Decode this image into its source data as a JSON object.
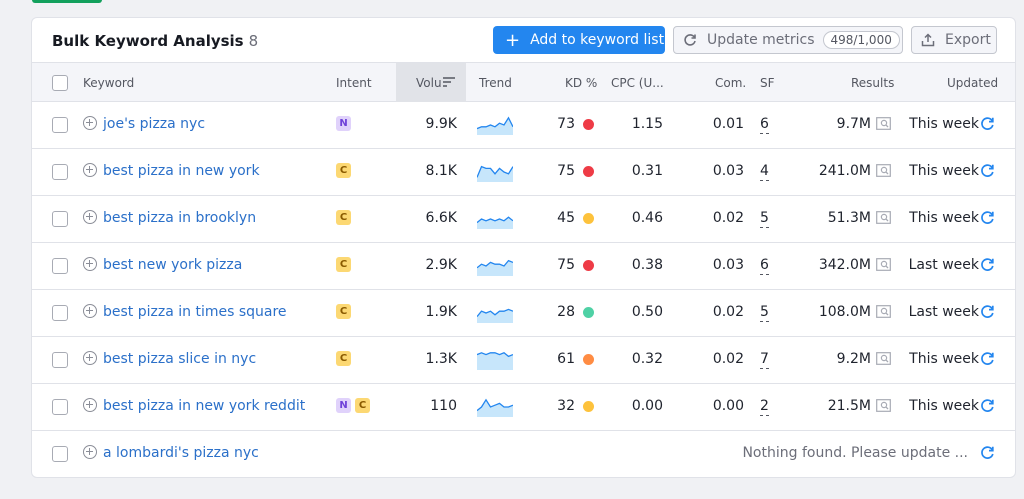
{
  "header": {
    "title": "Bulk Keyword Analysis",
    "count": "8",
    "add_button_label": "Add to keyword list",
    "update_button_label": "Update metrics",
    "update_badge": "498/1,000",
    "export_button_label": "Export"
  },
  "columns": {
    "keyword": "Keyword",
    "intent": "Intent",
    "volume": "Volu",
    "trend": "Trend",
    "kd": "KD %",
    "cpc": "CPC (U...",
    "com": "Com.",
    "sf": "SF",
    "results": "Results",
    "updated": "Updated"
  },
  "rows": [
    {
      "keyword": "joe's pizza nyc",
      "intents": [
        "N"
      ],
      "volume": "9.9K",
      "trend": [
        3,
        4,
        4,
        5,
        4,
        6,
        5,
        9,
        4
      ],
      "kd": "73",
      "kd_color": "#ee3b46",
      "cpc": "1.15",
      "com": "0.01",
      "sf": "6",
      "results": "9.7M",
      "updated": "This week"
    },
    {
      "keyword": "best pizza in new york",
      "intents": [
        "C"
      ],
      "volume": "8.1K",
      "trend": [
        2,
        8,
        7,
        7,
        4,
        7,
        5,
        4,
        8
      ],
      "kd": "75",
      "kd_color": "#ee3b46",
      "cpc": "0.31",
      "com": "0.03",
      "sf": "4",
      "results": "241.0M",
      "updated": "This week"
    },
    {
      "keyword": "best pizza in brooklyn",
      "intents": [
        "C"
      ],
      "volume": "6.6K",
      "trend": [
        3,
        5,
        4,
        5,
        4,
        5,
        4,
        6,
        4
      ],
      "kd": "45",
      "kd_color": "#fdc23c",
      "cpc": "0.46",
      "com": "0.02",
      "sf": "5",
      "results": "51.3M",
      "updated": "This week"
    },
    {
      "keyword": "best new york pizza",
      "intents": [
        "C"
      ],
      "volume": "2.9K",
      "trend": [
        4,
        6,
        5,
        7,
        6,
        6,
        5,
        8,
        7
      ],
      "kd": "75",
      "kd_color": "#ee3b46",
      "cpc": "0.38",
      "com": "0.03",
      "sf": "6",
      "results": "342.0M",
      "updated": "Last week"
    },
    {
      "keyword": "best pizza in times square",
      "intents": [
        "C"
      ],
      "volume": "1.9K",
      "trend": [
        3,
        6,
        5,
        6,
        4,
        6,
        6,
        7,
        6
      ],
      "kd": "28",
      "kd_color": "#4fd1a5",
      "cpc": "0.50",
      "com": "0.02",
      "sf": "5",
      "results": "108.0M",
      "updated": "Last week"
    },
    {
      "keyword": "best pizza slice in nyc",
      "intents": [
        "C"
      ],
      "volume": "1.3K",
      "trend": [
        8,
        9,
        8,
        9,
        9,
        8,
        9,
        7,
        8
      ],
      "kd": "61",
      "kd_color": "#ff8c43",
      "cpc": "0.32",
      "com": "0.02",
      "sf": "7",
      "results": "9.2M",
      "updated": "This week"
    },
    {
      "keyword": "best pizza in new york reddit",
      "intents": [
        "N",
        "C"
      ],
      "volume": "110",
      "trend": [
        3,
        5,
        9,
        5,
        6,
        7,
        5,
        5,
        6
      ],
      "kd": "32",
      "kd_color": "#fdc23c",
      "cpc": "0.00",
      "com": "0.00",
      "sf": "2",
      "results": "21.5M",
      "updated": "This week"
    },
    {
      "keyword": "a lombardi's pizza nyc",
      "nothing": "Nothing found. Please update ..."
    }
  ],
  "colors": {
    "accent": "#2386ef",
    "link": "#2b70c9"
  },
  "icons": [
    "plus-icon",
    "refresh-icon",
    "export-icon",
    "sort-icon",
    "add-keyword-icon",
    "serp-icon"
  ]
}
